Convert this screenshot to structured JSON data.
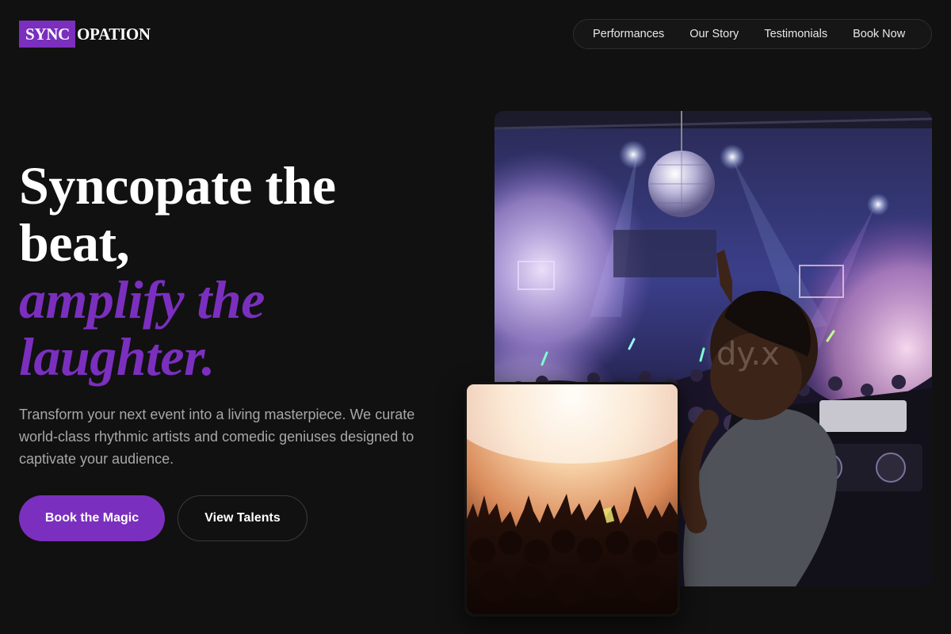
{
  "header": {
    "logo_highlight": "SYNC",
    "logo_rest": "OPATION",
    "nav": [
      "Performances",
      "Our Story",
      "Testimonials",
      "Book Now"
    ]
  },
  "hero": {
    "headline_line1": "Syncopate the",
    "headline_line2": "beat,",
    "headline_line3": "amplify the",
    "headline_line4": "laughter.",
    "lead": "Transform your next event into a living masterpiece. We curate world-class rhythmic artists and comedic geniuses designed to captivate your audience.",
    "primary_cta": "Book the Magic",
    "secondary_cta": "View Talents"
  },
  "colors": {
    "accent": "#7b2fbe",
    "background": "#111111"
  }
}
